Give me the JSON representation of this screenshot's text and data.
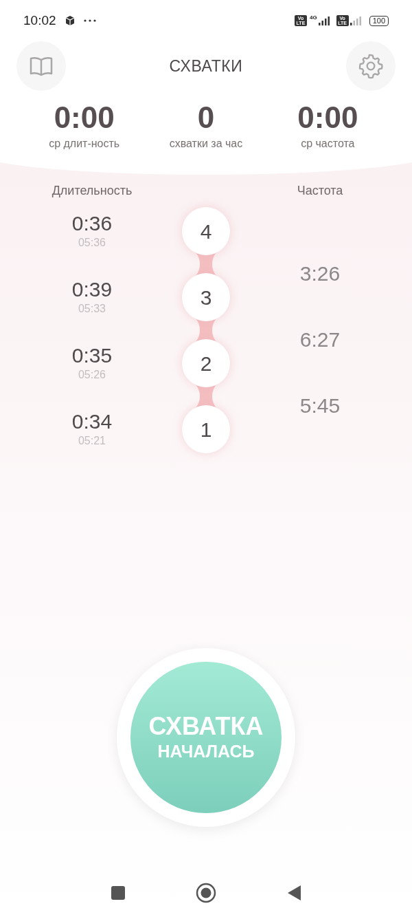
{
  "status_bar": {
    "time": "10:02",
    "sim_badges": [
      {
        "top": "Vo",
        "bottom": "LTE"
      },
      {
        "top": "Vo",
        "bottom": "LTE"
      }
    ],
    "network": "4G",
    "battery": "100"
  },
  "header": {
    "title": "СХВАТКИ"
  },
  "stats": [
    {
      "value": "0:00",
      "label": "ср длит-ность"
    },
    {
      "value": "0",
      "label": "схватки за час"
    },
    {
      "value": "0:00",
      "label": "ср частота"
    }
  ],
  "columns": {
    "duration": "Длительность",
    "frequency": "Частота"
  },
  "contractions": [
    {
      "number": "4",
      "duration": "0:36",
      "start": "05:36"
    },
    {
      "number": "3",
      "duration": "0:39",
      "start": "05:33"
    },
    {
      "number": "2",
      "duration": "0:35",
      "start": "05:26"
    },
    {
      "number": "1",
      "duration": "0:34",
      "start": "05:21"
    }
  ],
  "intervals": [
    "3:26",
    "6:27",
    "5:45"
  ],
  "start_button": {
    "line_1": "СХВАТКА",
    "line_2": "НАЧАЛАСЬ"
  }
}
